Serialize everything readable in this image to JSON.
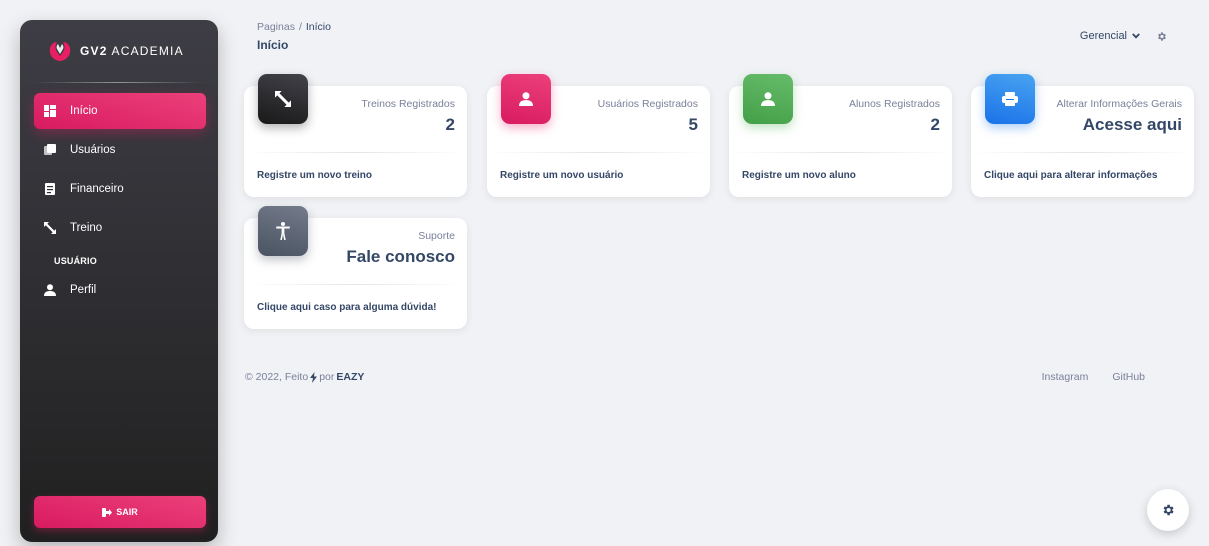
{
  "brand": {
    "name_bold": "GV2",
    "name_rest": "ACADEMIA"
  },
  "sidebar": {
    "items": [
      {
        "label": "Início",
        "icon": "dashboard-icon",
        "active": true
      },
      {
        "label": "Usuários",
        "icon": "users-icon",
        "active": false
      },
      {
        "label": "Financeiro",
        "icon": "receipt-icon",
        "active": false
      },
      {
        "label": "Treino",
        "icon": "arrows-icon",
        "active": false
      }
    ],
    "section_label": "USUÁRIO",
    "profile_label": "Perfil",
    "logout_label": "SAIR"
  },
  "breadcrumb": {
    "root": "Paginas",
    "separator": "/",
    "current": "Início"
  },
  "page_title": "Início",
  "topnav": {
    "dropdown_label": "Gerencial"
  },
  "cards": [
    {
      "label": "Treinos Registrados",
      "value": "2",
      "link": "Registre um novo treino",
      "icon": "arrows-icon",
      "color": "#191919"
    },
    {
      "label": "Usuários Registrados",
      "value": "5",
      "link": "Registre um novo usuário",
      "icon": "user-icon",
      "color": "#d81b60"
    },
    {
      "label": "Alunos Registrados",
      "value": "2",
      "link": "Registre um novo aluno",
      "icon": "user-icon",
      "color": "#43a047"
    },
    {
      "label": "Alterar Informações Gerais",
      "value": "Acesse aqui",
      "link": "Clique aqui para alterar informações",
      "icon": "print-icon",
      "color": "#1a73e8"
    },
    {
      "label": "Suporte",
      "value": "Fale conosco",
      "link": "Clique aqui caso para alguma dúvida!",
      "icon": "accessibility-icon",
      "color": "#495361"
    }
  ],
  "footer": {
    "prefix": "© 2022, Feito",
    "by": "por",
    "author": "EAZY",
    "links": [
      "Instagram",
      "GitHub"
    ]
  }
}
